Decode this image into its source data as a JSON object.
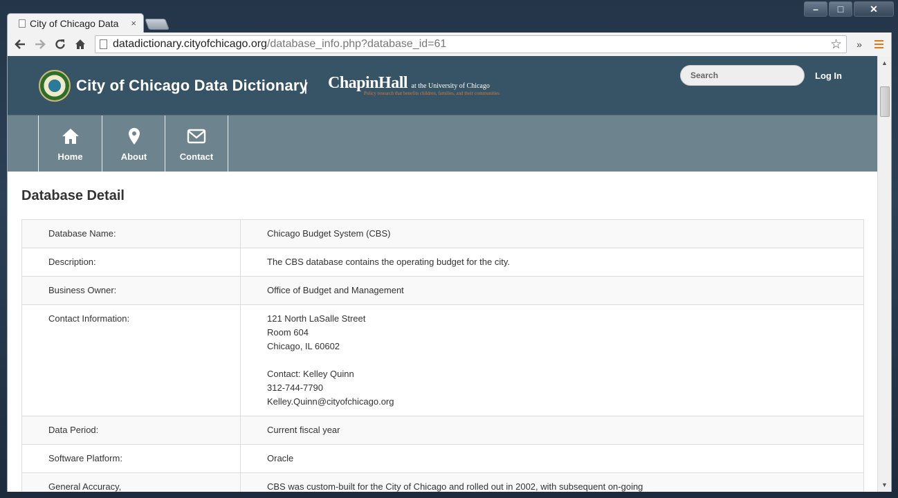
{
  "browser": {
    "tab_title": "City of Chicago Data",
    "tab_close": "×",
    "url_domain": "datadictionary.cityofchicago.org",
    "url_path": "/database_info.php?database_id=61",
    "window_controls": [
      "–",
      "□",
      "✕"
    ],
    "extra_btn": "»"
  },
  "header": {
    "site_title": "City of Chicago Data Dictionary",
    "separator": "|",
    "chapin_name": "ChapinHall",
    "chapin_sub": "at the University of Chicago",
    "chapin_tagline": "Policy research that benefits children, families, and their communities",
    "search_placeholder": "Search",
    "login_label": "Log In"
  },
  "nav": {
    "items": [
      {
        "label": "Home",
        "icon": "home-icon"
      },
      {
        "label": "About",
        "icon": "map-pin-icon"
      },
      {
        "label": "Contact",
        "icon": "envelope-icon"
      }
    ]
  },
  "main": {
    "heading": "Database Detail",
    "rows": [
      {
        "label": "Database Name:",
        "value": "Chicago Budget System (CBS)"
      },
      {
        "label": "Description:",
        "value": "The CBS database contains the operating budget for the city."
      },
      {
        "label": "Business Owner:",
        "value": "Office of Budget and Management"
      },
      {
        "label": "Contact Information:",
        "value": "121 North LaSalle Street\nRoom 604\nChicago, IL 60602\n\nContact: Kelley Quinn\n312-744-7790\nKelley.Quinn@cityofchicago.org"
      },
      {
        "label": "Data Period:",
        "value": "Current fiscal year"
      },
      {
        "label": "Software Platform:",
        "value": "Oracle"
      },
      {
        "label": "General Accuracy,\nCompleteness, Limitations:",
        "value": "CBS was custom-built for the City of Chicago and rolled out in 2002, with subsequent on-going\nenhancements. Data is added and updated daily in the system for any given fiscal year. Upon"
      }
    ]
  },
  "colors": {
    "header_bg": "#365466",
    "nav_bg": "#6d838e",
    "chapin_accent": "#d87a3a",
    "menu_accent": "#e07a10"
  }
}
